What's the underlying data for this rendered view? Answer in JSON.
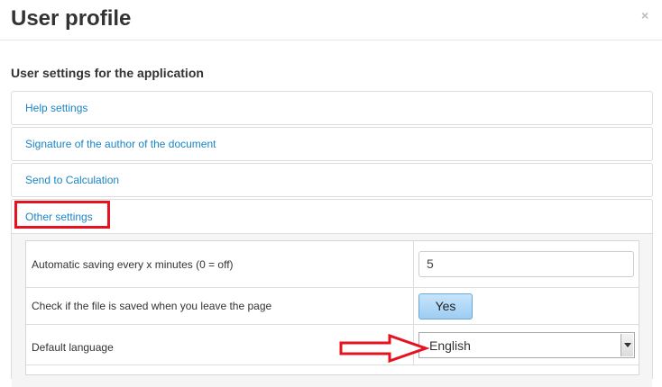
{
  "dialog": {
    "title": "User profile",
    "close_glyph": "×",
    "section_heading": "User settings for the application"
  },
  "panels": [
    {
      "label": "Help settings"
    },
    {
      "label": "Signature of the author of the document"
    },
    {
      "label": "Send to Calculation"
    }
  ],
  "open_panel": {
    "label": "Other settings",
    "rows": {
      "autosave": {
        "label": "Automatic saving every x minutes (0 = off)",
        "value": "5"
      },
      "check_saved": {
        "label": "Check if the file is saved when you leave the page",
        "toggle": "Yes"
      },
      "language": {
        "label": "Default language",
        "selected": "English"
      }
    }
  },
  "colors": {
    "link": "#1a85c5",
    "annotation_red": "#e4131f",
    "toggle_blue": "#9ccdf3"
  },
  "icons": {
    "close": "close-icon",
    "dropdown": "chevron-down-icon",
    "annotation": "arrow-right-icon"
  }
}
